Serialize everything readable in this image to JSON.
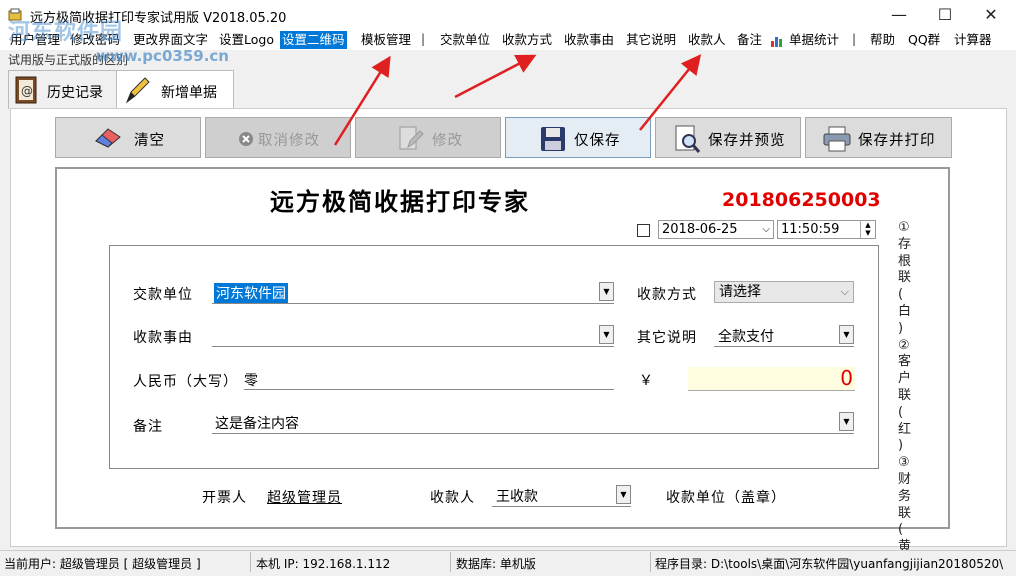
{
  "window": {
    "title": "远方极简收据打印专家试用版 V2018.05.20",
    "minimize": "—",
    "maximize": "☐",
    "close": "✕"
  },
  "watermark": {
    "site_name": "河东软件园",
    "site_url": "www.pc0359.cn"
  },
  "menu": {
    "items": [
      "用户管理",
      "修改密码",
      "更改界面文字",
      "设置Logo",
      "设置二维码",
      "模板管理"
    ],
    "items2": [
      "交款单位",
      "收款方式",
      "收款事由",
      "其它说明",
      "收款人",
      "备注"
    ],
    "stats": "单据统计",
    "items3": [
      "帮助",
      "QQ群",
      "计算器"
    ],
    "sep": "|",
    "second_line": "试用版与正式版的区别"
  },
  "tabs": {
    "history": "历史记录",
    "new": "新增单据"
  },
  "toolbar": {
    "clear": "清空",
    "cancel_edit": "取消修改",
    "edit": "修改",
    "save_only": "仅保存",
    "save_preview": "保存并预览",
    "save_print": "保存并打印"
  },
  "receipt": {
    "title": "远方极简收据打印专家",
    "number": "201806250003",
    "date": "2018-06-25",
    "time": "11:50:59",
    "side_text": [
      "①",
      "存",
      "根",
      "联",
      "(",
      "白",
      ")",
      "②",
      "客",
      "户",
      "联",
      "(",
      "红",
      ")",
      "③",
      "财",
      "务",
      "联",
      "(",
      "黄",
      ")"
    ],
    "payer_label": "交款单位",
    "payer_value": "河东软件园",
    "method_label": "收款方式",
    "method_value": "请选择",
    "reason_label": "收款事由",
    "reason_value": "",
    "other_label": "其它说明",
    "other_value": "全款支付",
    "rmb_label": "人民币（大写）",
    "rmb_value": "零",
    "yen_symbol": "￥",
    "amount": "0",
    "note_label": "备注",
    "note_value": "这是备注内容",
    "drawer_label": "开票人",
    "drawer_value": "超级管理员",
    "payee_label": "收款人",
    "payee_value": "王收款",
    "seal_label": "收款单位（盖章）"
  },
  "status": {
    "user": "当前用户: 超级管理员 [ 超级管理员 ]",
    "ip": "本机 IP: 192.168.1.112",
    "db": "数据库: 单机版",
    "dir": "程序目录: D:\\tools\\桌面\\河东软件园\\yuanfangjijian20180520\\"
  },
  "colors": {
    "accent": "#0078d7",
    "number_red": "#e00000",
    "amount_bg": "#fffde0",
    "arrow_red": "#e02020"
  }
}
